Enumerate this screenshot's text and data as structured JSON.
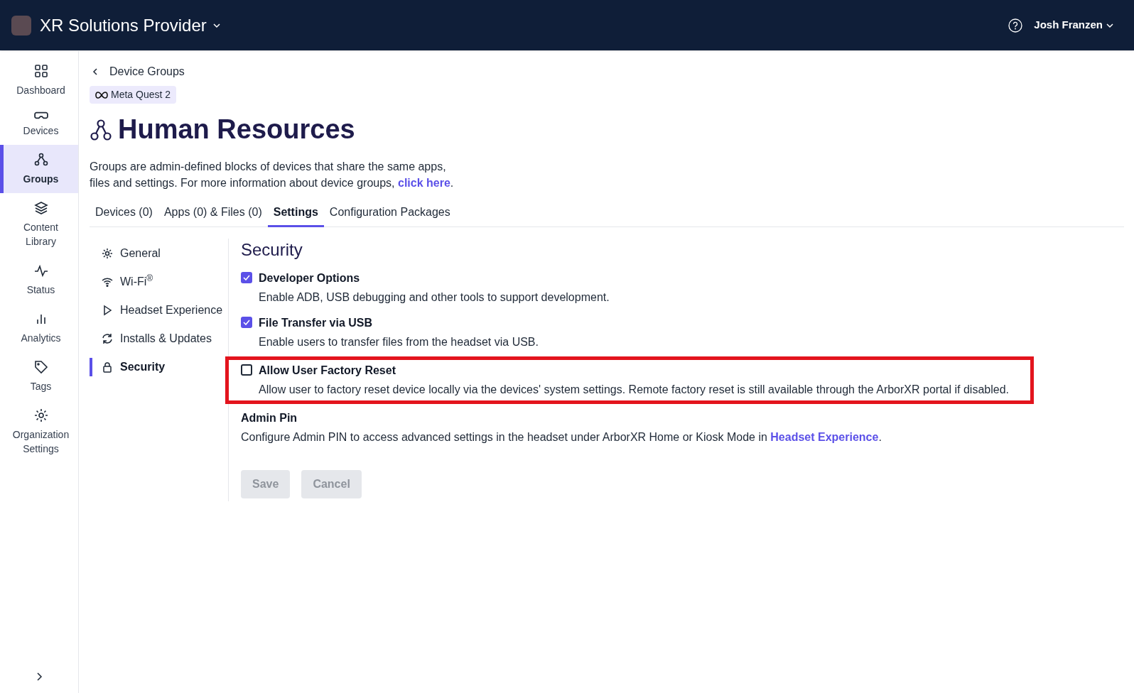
{
  "header": {
    "org_name": "XR Solutions Provider",
    "user_name": "Josh Franzen"
  },
  "sidebar": {
    "items": [
      {
        "label": "Dashboard",
        "selected": false
      },
      {
        "label": "Devices",
        "selected": false
      },
      {
        "label": "Groups",
        "selected": true
      },
      {
        "label": "Content Library",
        "selected": false
      },
      {
        "label": "Status",
        "selected": false
      },
      {
        "label": "Analytics",
        "selected": false
      },
      {
        "label": "Tags",
        "selected": false
      },
      {
        "label": "Organization Settings",
        "selected": false
      }
    ]
  },
  "breadcrumb": "Device Groups",
  "device_badge": "Meta Quest 2",
  "title": "Human Resources",
  "description": {
    "text": "Groups are admin-defined blocks of devices that share the same apps, files and settings. For more information about device groups, ",
    "link": "click here",
    "after": "."
  },
  "tabs": [
    {
      "label": "Devices (0)",
      "selected": false
    },
    {
      "label": "Apps (0) & Files (0)",
      "selected": false
    },
    {
      "label": "Settings",
      "selected": true
    },
    {
      "label": "Configuration Packages",
      "selected": false
    }
  ],
  "settings_nav": [
    {
      "label": "General",
      "selected": false
    },
    {
      "label": "Wi-Fi$^{®}$",
      "selected": false
    },
    {
      "label": "Headset Experience",
      "selected": false
    },
    {
      "label": "Installs & Updates",
      "selected": false
    },
    {
      "label": "Security",
      "selected": true
    }
  ],
  "section_title": "Security",
  "options": [
    {
      "label": "Developer Options",
      "description": "Enable ADB, USB debugging and other tools to support development.",
      "checked": true,
      "highlighted": false
    },
    {
      "label": "File Transfer via USB",
      "description": "Enable users to transfer files from the headset via USB.",
      "checked": true,
      "highlighted": false
    },
    {
      "label": "Allow User Factory Reset",
      "description": "Allow user to factory reset device locally via the devices' system settings. Remote factory reset is still available through the ArborXR portal if disabled.",
      "checked": false,
      "highlighted": true
    }
  ],
  "admin_pin": {
    "title": "Admin Pin",
    "text": "Configure Admin PIN to access advanced settings in the headset under ArborXR Home or Kiosk Mode in ",
    "link": "Headset Experience",
    "after": "."
  },
  "buttons": [
    {
      "label": "Save",
      "disabled": true
    },
    {
      "label": "Cancel",
      "disabled": true
    }
  ]
}
